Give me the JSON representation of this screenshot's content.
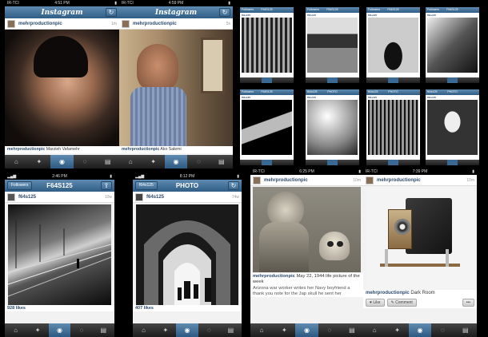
{
  "screens": {
    "s1": {
      "status_left": "IR-TCI",
      "status_time": "4:51 PM",
      "title": "Instagram",
      "user": "mehrproductionpic",
      "time": "1m",
      "caption_user": "mehrproductionpic",
      "caption_text": " Marzieh Vafamehr"
    },
    "s2": {
      "status_left": "IR-TCI",
      "status_time": "4:59 PM",
      "title": "Instagram",
      "user": "mehrproductionpic",
      "time": "5s",
      "caption_user": "mehrproductionpic",
      "caption_text": " Ako Salemi"
    },
    "s3": {
      "status_time": "2:46 PM",
      "back": "Followers",
      "title": "F64S125",
      "user": "f64s125",
      "time": "10w",
      "likes": "928 likes"
    },
    "s4": {
      "status_time": "8:12 PM",
      "back": "f64s125",
      "title": "PHOTO",
      "user": "f64s125",
      "time": "74w",
      "likes": "407 likes"
    },
    "s5": {
      "status_left": "IR-TCI",
      "status_time": "6:25 PM",
      "user": "mehrproductionpic",
      "time": "10m",
      "caption_user": "mehrproductionpic",
      "caption_text": " May 22, 1944 life picture of the week",
      "caption_more": "Arizona war worker writes her Navy boyfriend a thank you note for the Jap skull he sent her"
    },
    "s6": {
      "status_left": "IR-TCI",
      "status_time": "7:39 PM",
      "user": "mehrproductionpic",
      "time": "10m",
      "caption_user": "mehrproductionpic",
      "caption_text": " Dark Room",
      "like": "Like",
      "comment": "Comment",
      "more": "•••"
    }
  },
  "minis": [
    {
      "title": "F64S125",
      "back": "Followers"
    },
    {
      "title": "F64S125",
      "back": "Followers"
    },
    {
      "title": "F64S125",
      "back": "Followers"
    },
    {
      "title": "F64S125",
      "back": "Followers"
    },
    {
      "title": "F64S125",
      "back": "Followers"
    },
    {
      "title": "PHOTO",
      "back": "f64s125"
    },
    {
      "title": "PHOTO",
      "back": "f64s125"
    },
    {
      "title": "PHOTO",
      "back": "f64s125"
    }
  ],
  "tabs": [
    "home-icon",
    "explore-icon",
    "camera-icon",
    "news-icon",
    "profile-icon"
  ],
  "colors": {
    "nav": "#3a6a93",
    "user": "#2c4a6e"
  }
}
